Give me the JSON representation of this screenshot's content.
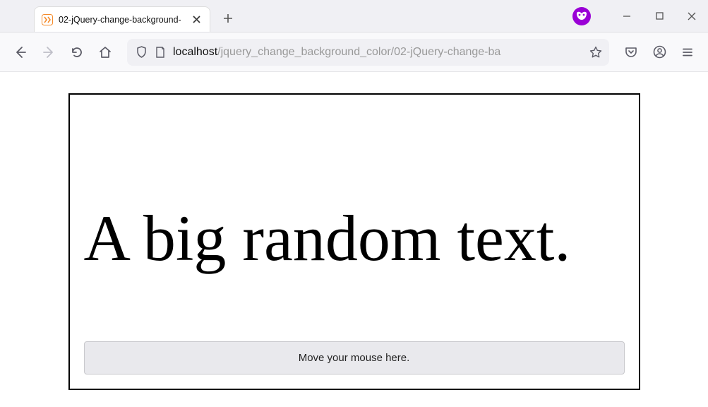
{
  "tab": {
    "title": "02-jQuery-change-background-"
  },
  "address": {
    "host": "localhost",
    "path": "/jquery_change_background_color/02-jQuery-change-ba"
  },
  "content": {
    "big_text": "A big random text.",
    "button_label": "Move your mouse here."
  }
}
